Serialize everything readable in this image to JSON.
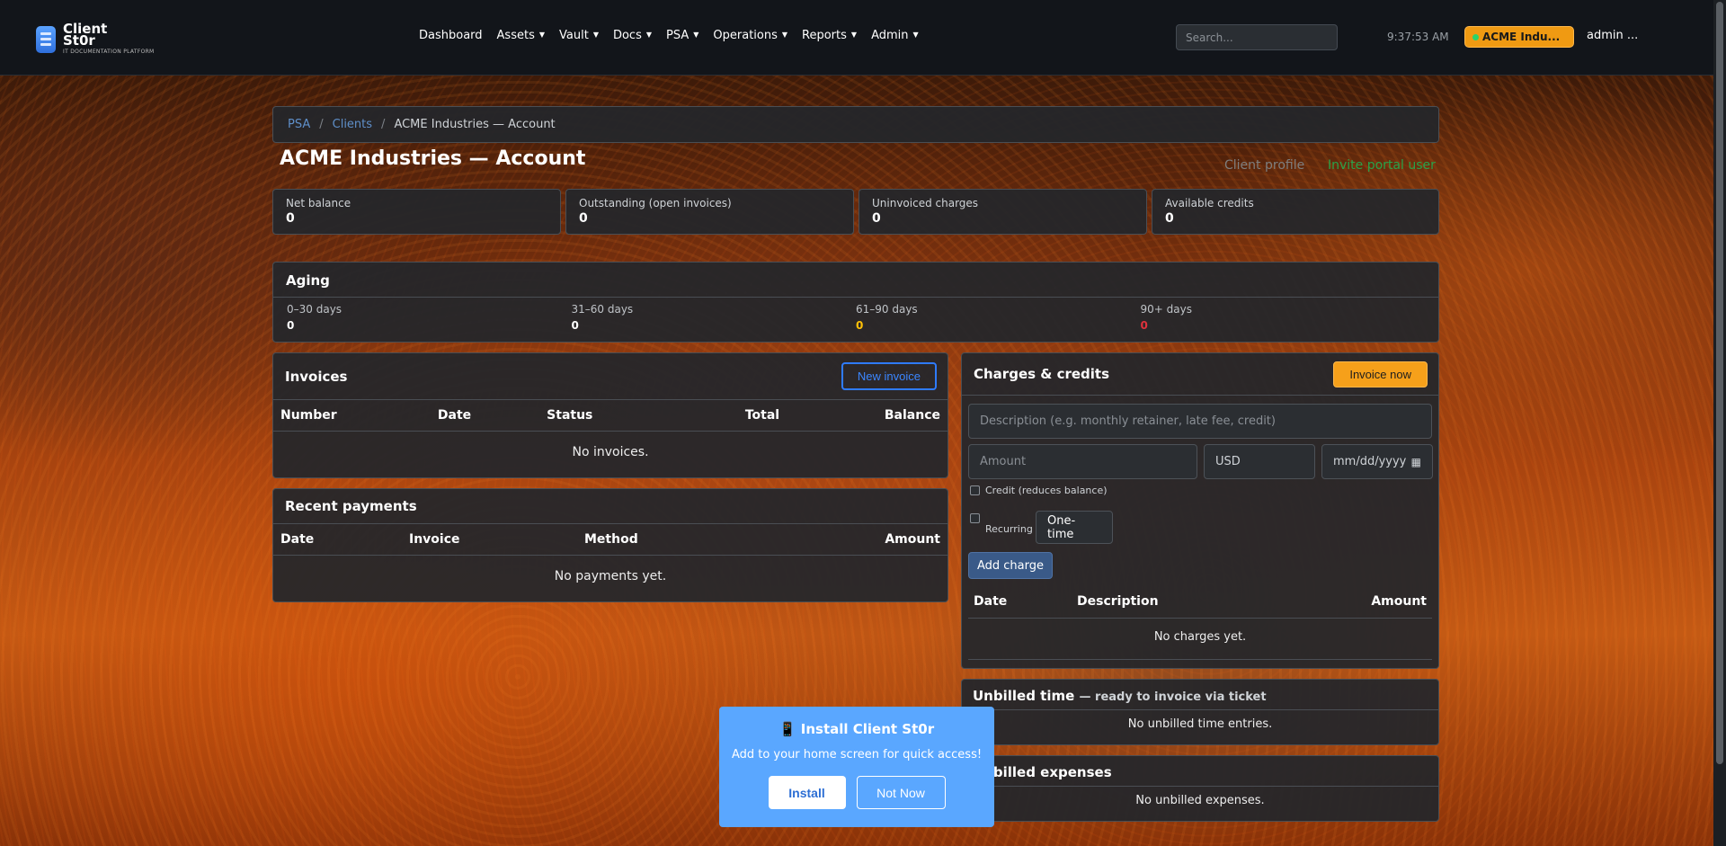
{
  "brand": {
    "name": "Client St0r",
    "sub": "IT DOCUMENTATION PLATFORM"
  },
  "nav": {
    "items": [
      "Dashboard",
      "Assets",
      "Vault",
      "Docs",
      "PSA",
      "Operations",
      "Reports",
      "Admin"
    ],
    "search_placeholder": "Search...",
    "clock": "9:37:53 AM",
    "client": "ACME Indu...",
    "user": "admin ..."
  },
  "breadcrumb": {
    "psa": "PSA",
    "clients": "Clients",
    "current": "ACME Industries — Account",
    "sep": "/"
  },
  "page": {
    "title": "ACME Industries — Account",
    "client_profile": "Client profile",
    "invite": "Invite portal user"
  },
  "stats": [
    {
      "label": "Net balance",
      "value": "0"
    },
    {
      "label": "Outstanding (open invoices)",
      "value": "0"
    },
    {
      "label": "Uninvoiced charges",
      "value": "0"
    },
    {
      "label": "Available credits",
      "value": "0"
    }
  ],
  "aging": {
    "title": "Aging",
    "buckets": [
      {
        "label": "0–30 days",
        "value": "0",
        "color": "#ffffff"
      },
      {
        "label": "31–60 days",
        "value": "0",
        "color": "#ffffff"
      },
      {
        "label": "61–90 days",
        "value": "0",
        "color": "#ffc107"
      },
      {
        "label": "90+ days",
        "value": "0",
        "color": "#e0323c"
      }
    ]
  },
  "invoices": {
    "title": "Invoices",
    "new_button": "New invoice",
    "columns": [
      "Number",
      "Date",
      "Status",
      "Total",
      "Balance"
    ],
    "empty": "No invoices."
  },
  "payments": {
    "title": "Recent payments",
    "columns": [
      "Date",
      "Invoice",
      "Method",
      "Amount"
    ],
    "empty": "No payments yet."
  },
  "charges": {
    "title": "Charges & credits",
    "invoice_now": "Invoice now",
    "desc_placeholder": "Description (e.g. monthly retainer, late fee, credit)",
    "amount_placeholder": "Amount",
    "currency": "USD",
    "date_placeholder": "mm/dd/yyyy",
    "credit_label": "Credit (reduces balance)",
    "recurring_label": "Recurring",
    "frequency": "One-time",
    "add_button": "Add charge",
    "columns": [
      "Date",
      "Description",
      "Amount"
    ],
    "empty": "No charges yet."
  },
  "unbilled_time": {
    "title": "Unbilled time",
    "sub": "— ready to invoice via ticket",
    "empty": "No unbilled time entries."
  },
  "unbilled_expenses": {
    "title": "Unbilled expenses",
    "empty": "No unbilled expenses."
  },
  "install": {
    "title": "📱 Install Client St0r",
    "sub": "Add to your home screen for quick access!",
    "install": "Install",
    "not_now": "Not Now"
  }
}
